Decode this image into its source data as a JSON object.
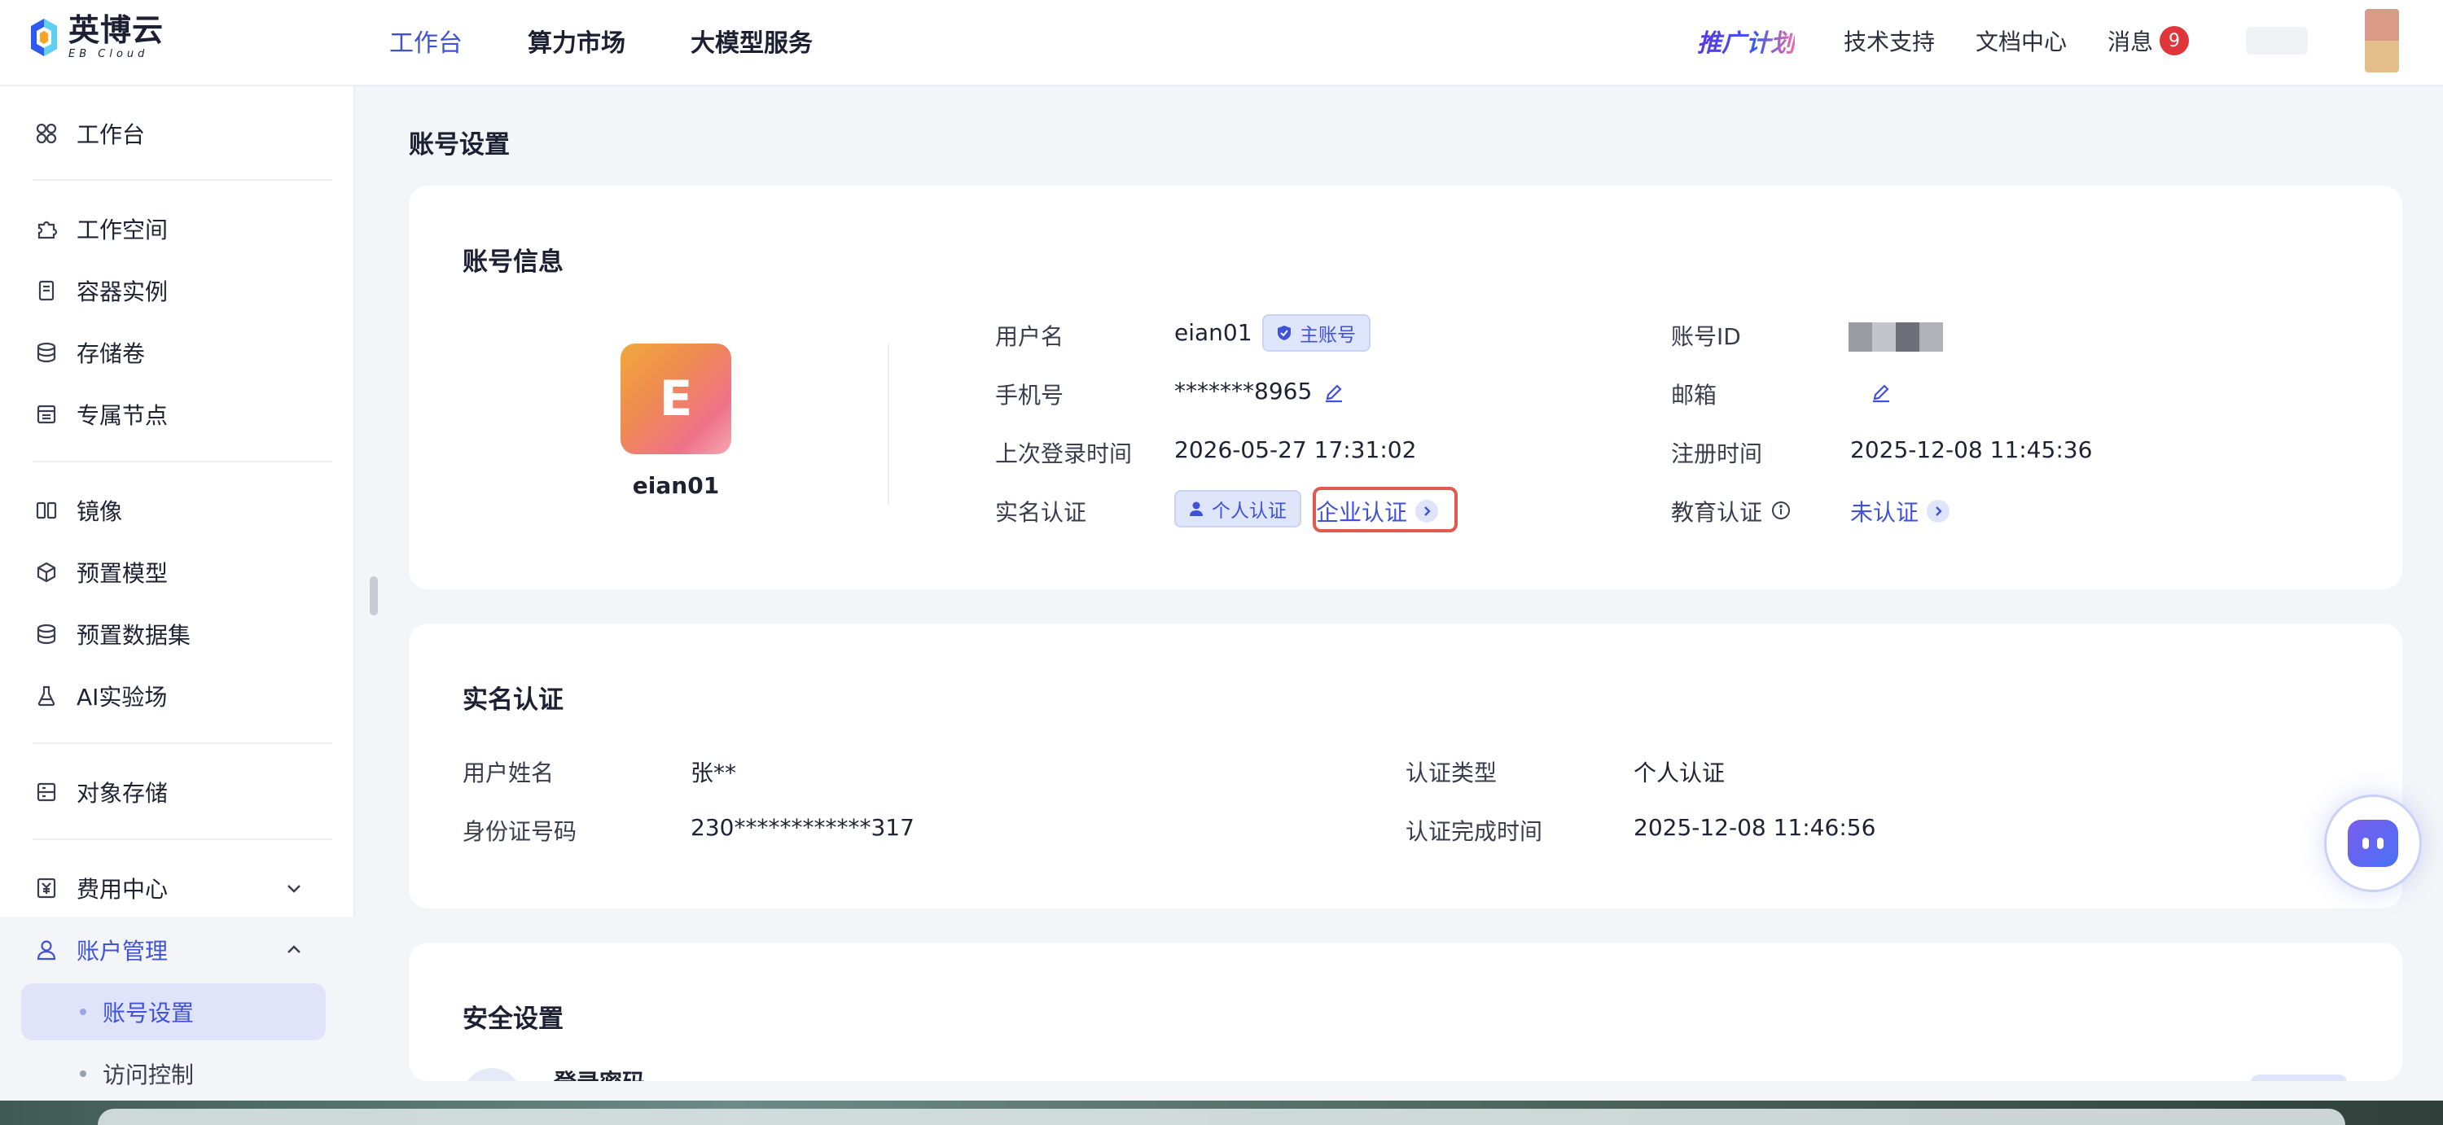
{
  "brand": {
    "name": "英博云",
    "sub": "EB Cloud"
  },
  "topnav": {
    "items": [
      "工作台",
      "算力市场",
      "大模型服务"
    ],
    "active_index": 0
  },
  "topright": {
    "promo": "推广计划",
    "support": "技术支持",
    "docs": "文档中心",
    "messages": "消息",
    "message_count": "9"
  },
  "sidebar": {
    "items": [
      {
        "label": "工作台",
        "icon": "workbench-icon"
      },
      {
        "label": "工作空间",
        "icon": "workspace-icon"
      },
      {
        "label": "容器实例",
        "icon": "container-icon"
      },
      {
        "label": "存储卷",
        "icon": "storage-volume-icon"
      },
      {
        "label": "专属节点",
        "icon": "dedicated-node-icon"
      },
      {
        "label": "镜像",
        "icon": "image-icon"
      },
      {
        "label": "预置模型",
        "icon": "preset-model-icon"
      },
      {
        "label": "预置数据集",
        "icon": "preset-dataset-icon"
      },
      {
        "label": "AI实验场",
        "icon": "ai-lab-icon"
      },
      {
        "label": "对象存储",
        "icon": "object-storage-icon"
      },
      {
        "label": "费用中心",
        "icon": "billing-icon"
      },
      {
        "label": "账户管理",
        "icon": "account-icon"
      }
    ],
    "sub_items": [
      {
        "label": "账号设置",
        "active": true
      },
      {
        "label": "访问控制",
        "active": false
      }
    ]
  },
  "page": {
    "title": "账号设置"
  },
  "account_info": {
    "title": "账号信息",
    "avatar_letter": "E",
    "display_name": "eian01",
    "username_label": "用户名",
    "username": "eian01",
    "main_account_tag": "主账号",
    "phone_label": "手机号",
    "phone": "*******8965",
    "last_login_label": "上次登录时间",
    "last_login": "2026-05-27 17:31:02",
    "realname_label": "实名认证",
    "personal_tag": "个人认证",
    "enterprise_link": "企业认证",
    "account_id_label": "账号ID",
    "email_label": "邮箱",
    "register_label": "注册时间",
    "register_time": "2025-12-08 11:45:36",
    "edu_label": "教育认证",
    "edu_status": "未认证"
  },
  "realname": {
    "title": "实名认证",
    "name_label": "用户姓名",
    "name": "张**",
    "id_label": "身份证号码",
    "id_number": "230************317",
    "type_label": "认证类型",
    "type": "个人认证",
    "done_label": "认证完成时间",
    "done_time": "2025-12-08 11:46:56"
  },
  "security": {
    "title": "安全设置",
    "login_password": "登录密码"
  },
  "colors": {
    "accent": "#3f52d8",
    "highlight_box": "#e05a4f",
    "badge": "#e0363b"
  }
}
